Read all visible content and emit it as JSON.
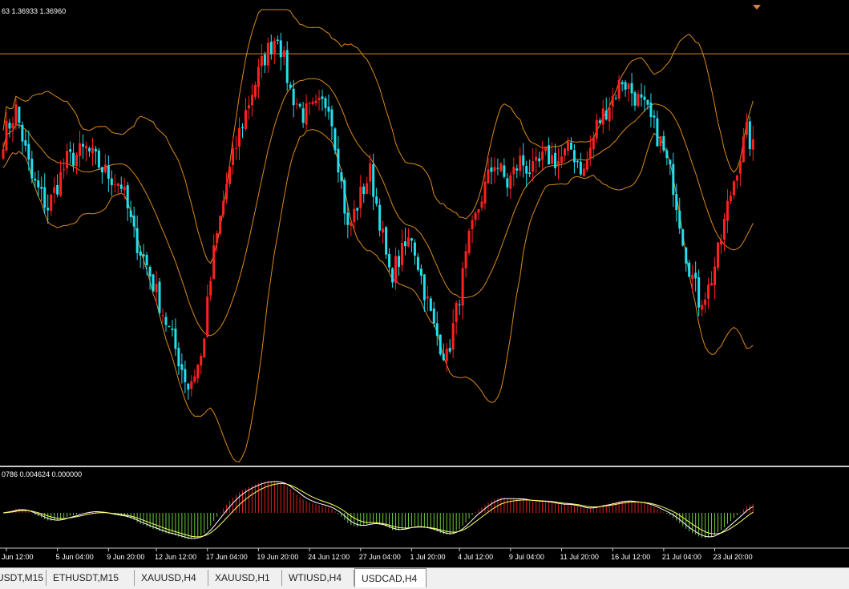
{
  "symbol": "USDCAD,H4",
  "main_readout": "63 1.36933 1.36960",
  "macd_readout": "0786 0.004624 0.000000",
  "colors": {
    "background": "#000000",
    "bull": "#ff2020",
    "bear": "#22e0ee",
    "bands": "#d9891e",
    "price_line": "#d9891e",
    "macd_up": "#e02020",
    "macd_down": "#6ccc36",
    "macd_line": "#ffffff",
    "signal_line": "#ffff66"
  },
  "tabs": [
    {
      "label": "USDT,M15",
      "active": false
    },
    {
      "label": "ETHUSDT,M15",
      "active": false
    },
    {
      "label": "XAUUSD,H4",
      "active": false
    },
    {
      "label": "XAUUSD,H1",
      "active": false
    },
    {
      "label": "WTIUSD,H4",
      "active": false
    },
    {
      "label": "USDCAD,H4",
      "active": true
    }
  ],
  "chart_data": {
    "type": "candlestick",
    "symbol": "USDCAD",
    "timeframe": "H4",
    "indicators": [
      "Bollinger Bands",
      "MACD"
    ],
    "price_range": [
      1.352,
      1.3715
    ],
    "current_price": 1.3696,
    "x_tick_labels": [
      "Jun 12:00",
      "5 Jun 04:00",
      "9 Jun 20:00",
      "12 Jun 12:00",
      "17 Jun 04:00",
      "19 Jun 20:00",
      "24 Jun 12:00",
      "27 Jun 04:00",
      "1 Jul 20:00",
      "4 Jul 12:00",
      "9 Jul 04:00",
      "11 Jul 20:00",
      "16 Jul 12:00",
      "21 Jul 04:00",
      "23 Jul 20:00"
    ],
    "x_tick_candle_index": [
      1,
      17,
      33,
      48,
      64,
      80,
      96,
      112,
      128,
      143,
      159,
      175,
      191,
      207,
      223
    ],
    "price_keypoints": [
      [
        0,
        1.366
      ],
      [
        4,
        1.3672
      ],
      [
        9,
        1.3642
      ],
      [
        14,
        1.363
      ],
      [
        20,
        1.365
      ],
      [
        26,
        1.3655
      ],
      [
        32,
        1.3645
      ],
      [
        37,
        1.364
      ],
      [
        41,
        1.3618
      ],
      [
        45,
        1.3605
      ],
      [
        50,
        1.3585
      ],
      [
        55,
        1.3565
      ],
      [
        58,
        1.3553
      ],
      [
        62,
        1.3565
      ],
      [
        66,
        1.361
      ],
      [
        70,
        1.364
      ],
      [
        74,
        1.3662
      ],
      [
        78,
        1.368
      ],
      [
        82,
        1.3695
      ],
      [
        86,
        1.3705
      ],
      [
        90,
        1.368
      ],
      [
        94,
        1.367
      ],
      [
        98,
        1.3672
      ],
      [
        102,
        1.3676
      ],
      [
        105,
        1.365
      ],
      [
        108,
        1.362
      ],
      [
        112,
        1.3635
      ],
      [
        115,
        1.3645
      ],
      [
        118,
        1.3625
      ],
      [
        121,
        1.36
      ],
      [
        125,
        1.361
      ],
      [
        128,
        1.3618
      ],
      [
        131,
        1.36
      ],
      [
        135,
        1.3578
      ],
      [
        139,
        1.3565
      ],
      [
        142,
        1.3585
      ],
      [
        146,
        1.3615
      ],
      [
        150,
        1.3635
      ],
      [
        154,
        1.365
      ],
      [
        158,
        1.364
      ],
      [
        162,
        1.365
      ],
      [
        166,
        1.3645
      ],
      [
        170,
        1.3652
      ],
      [
        174,
        1.365
      ],
      [
        178,
        1.3655
      ],
      [
        182,
        1.3645
      ],
      [
        186,
        1.3665
      ],
      [
        190,
        1.3675
      ],
      [
        194,
        1.3685
      ],
      [
        198,
        1.3678
      ],
      [
        202,
        1.367
      ],
      [
        206,
        1.3658
      ],
      [
        210,
        1.364
      ],
      [
        214,
        1.361
      ],
      [
        218,
        1.359
      ],
      [
        221,
        1.3595
      ],
      [
        224,
        1.361
      ],
      [
        227,
        1.363
      ],
      [
        230,
        1.3648
      ],
      [
        233,
        1.3662
      ],
      [
        235,
        1.3655
      ]
    ],
    "price_noise": 0.001,
    "bollinger": {
      "period": 20,
      "deviations": 2
    },
    "macd": {
      "fast": 12,
      "slow": 26,
      "signal": 9
    }
  }
}
